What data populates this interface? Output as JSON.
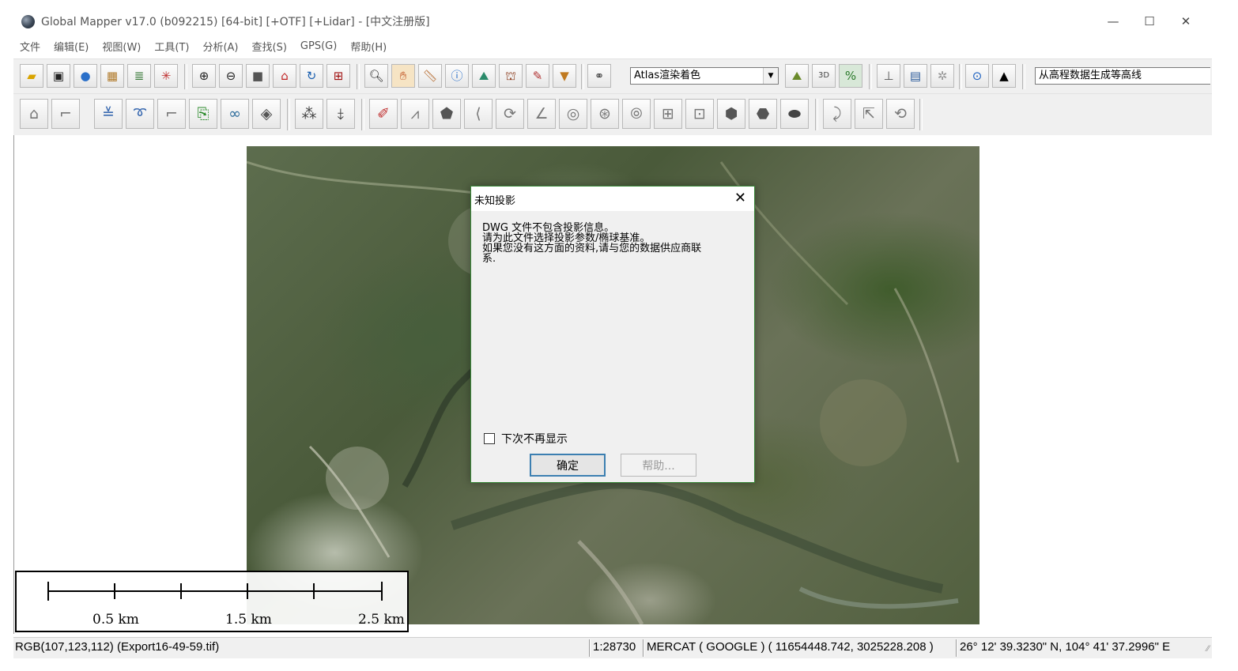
{
  "window": {
    "title": "Global Mapper v17.0 (b092215) [64-bit] [+OTF] [+Lidar] - [中文注册版]",
    "minimize_glyph": "—",
    "maximize_glyph": "☐",
    "close_glyph": "✕"
  },
  "menu": [
    {
      "label": "文件"
    },
    {
      "label": "编辑(E)"
    },
    {
      "label": "视图(W)"
    },
    {
      "label": "工具(T)"
    },
    {
      "label": "分析(A)"
    },
    {
      "label": "查找(S)"
    },
    {
      "label": "GPS(G)"
    },
    {
      "label": "帮助(H)"
    }
  ],
  "toolbar1": {
    "shader_combo": "Atlas渲染着色",
    "action_combo": "从高程数据生成等高线"
  },
  "map": {
    "scalebar": {
      "labels": [
        "0.5 km",
        "1.5 km",
        "2.5 km"
      ]
    }
  },
  "dialog": {
    "title": "未知投影",
    "message_lines": [
      "DWG 文件不包含投影信息。",
      "请为此文件选择投影参数/椭球基准。",
      "如果您没有这方面的资料,请与您的数据供应商联",
      "系."
    ],
    "dont_show_label": "下次不再显示",
    "dont_show_checked": false,
    "ok_label": "确定",
    "help_label": "帮助..."
  },
  "statusbar": {
    "pixel_info": "RGB(107,123,112) (Export16-49-59.tif)",
    "scale": "1:28730",
    "projection": "MERCAT ( GOOGLE ) ( 11654448.742, 3025228.208 )",
    "coordinates": "26° 12' 39.3230\" N, 104° 41' 37.2996\" E"
  }
}
